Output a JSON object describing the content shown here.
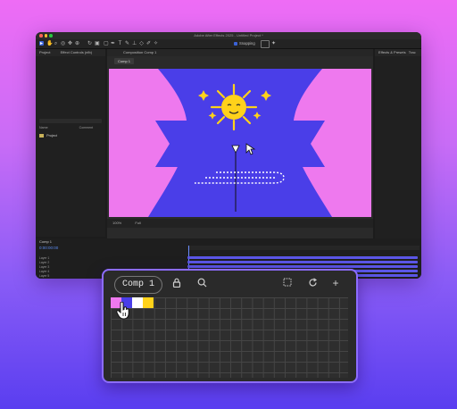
{
  "app": {
    "title": "Adobe After Effects 2025 - Untitled Project *",
    "traffic_lights": [
      "#ff5f57",
      "#febc2e",
      "#28c840"
    ]
  },
  "toolbar": {
    "snapping_label": "Snapping",
    "icons": [
      "selection-tool",
      "hand-tool",
      "zoom-tool",
      "orbit-tool",
      "pan-tool",
      "dolly-tool",
      "rotation-tool",
      "camera-tool",
      "mask-tool",
      "pen-tool",
      "type-tool",
      "brush-tool",
      "clone-tool",
      "eraser-tool",
      "roto-tool",
      "puppet-tool"
    ]
  },
  "panels": {
    "project_tab": "Project",
    "effect_controls_tab": "Effect Controls (nfb)",
    "composition_tab": "Composition Comp 1",
    "comp_view_tab": "Comp 1",
    "effects_tab": "Effects & Presets",
    "tracker_tab": "Trac"
  },
  "project": {
    "columns": [
      "Name",
      "Comment"
    ],
    "items": [
      {
        "name": "Project"
      }
    ]
  },
  "viewer": {
    "zoom": "100%",
    "resolution": "Full",
    "colors": {
      "background": "#ee79ee",
      "shape": "#4a3ee8",
      "sun": "#ffd21a",
      "accent": "#ffffff"
    }
  },
  "timeline": {
    "tab": "Comp 1",
    "timecode": "0:00:00:00",
    "layers": [
      "Layer 1",
      "Layer 2",
      "Layer 3",
      "Layer 4",
      "Layer 5"
    ]
  },
  "swatches_panel": {
    "name": "Comp 1",
    "icons": [
      "lock-icon",
      "search-icon",
      "selection-icon",
      "refresh-icon",
      "add-icon"
    ],
    "colors": [
      "#ee79ee",
      "#4a3ee8",
      "#ffffff",
      "#ffd21a"
    ],
    "add_symbol": "+"
  }
}
